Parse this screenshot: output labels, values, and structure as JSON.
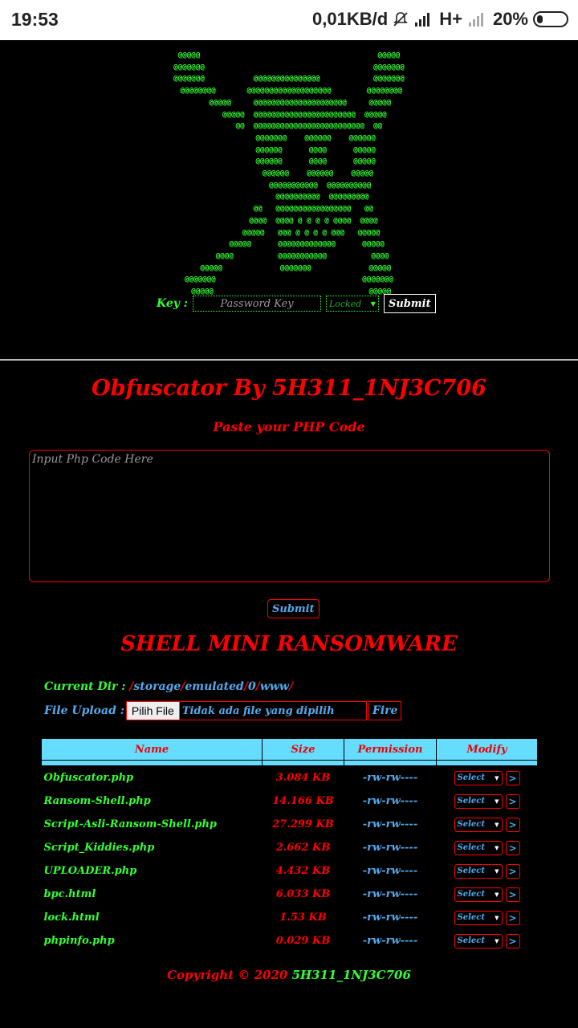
{
  "status": {
    "time": "19:53",
    "speed": "0,01KB/d",
    "network": "H+",
    "battery": "20%"
  },
  "skull_art": "@@@@@                                        @@@@@\n@@@@@@@                                      @@@@@@@\n@@@@@@@           @@@@@@@@@@@@@@@            @@@@@@@\n @@@@@@@@       @@@@@@@@@@@@@@@@@@@        @@@@@@@@\n     @@@@@     @@@@@@@@@@@@@@@@@@@@@     @@@@@\n       @@@@@  @@@@@@@@@@@@@@@@@@@@@@@  @@@@@\n         @@  @@@@@@@@@@@@@@@@@@@@@@@@@  @@\n            @@@@@@@    @@@@@@    @@@@@@\n            @@@@@@      @@@@      @@@@@\n            @@@@@@      @@@@      @@@@@\n             @@@@@@    @@@@@@    @@@@@\n              @@@@@@@@@@@  @@@@@@@@@@\n               @@@@@@@@@@  @@@@@@@@@\n           @@   @@@@@@@@@@@@@@@@@   @@\n           @@@@  @@@@ @ @ @ @ @@@@  @@@@\n          @@@@@   @@@ @ @ @ @ @@@   @@@@@\n        @@@@@      @@@@@@@@@@@@@      @@@@@\n      @@@@          @@@@@@@@@@@          @@@@\n   @@@@@             @@@@@@@             @@@@@\n@@@@@@@                                 @@@@@@@\n @@@@@                                   @@@@@",
  "login": {
    "key_label": "Key :",
    "password_placeholder": "Password Key",
    "locked_option": "Locked",
    "submit_label": "Submit"
  },
  "obfuscator": {
    "title": "Obfuscator By 5H311_1NJ3C706",
    "subtitle": "Paste your PHP Code",
    "placeholder": "Input Php Code Here",
    "submit_label": "Submit"
  },
  "shell": {
    "title": "SHELL MINI RANSOMWARE",
    "current_dir_label": "Current Dir :",
    "path_parts": [
      "storage",
      "emulated",
      "0",
      "www"
    ],
    "upload_label": "File Upload :",
    "choose_file_label": "Pilih File",
    "no_file_text": "Tidak ada file yang dipilih",
    "fire_label": "Fire",
    "columns": [
      "Name",
      "Size",
      "Permission",
      "Modify"
    ],
    "files": [
      {
        "name": "Obfuscator.php",
        "size": "3.084 KB",
        "perm": "-rw-rw----"
      },
      {
        "name": "Ransom-Shell.php",
        "size": "14.166 KB",
        "perm": "-rw-rw----"
      },
      {
        "name": "Script-Asli-Ransom-Shell.php",
        "size": "27.299 KB",
        "perm": "-rw-rw----"
      },
      {
        "name": "Script_Kiddies.php",
        "size": "2.662 KB",
        "perm": "-rw-rw----"
      },
      {
        "name": "UPLOADER.php",
        "size": "4.432 KB",
        "perm": "-rw-rw----"
      },
      {
        "name": "bpc.html",
        "size": "6.033 KB",
        "perm": "-rw-rw----"
      },
      {
        "name": "lock.html",
        "size": "1.53 KB",
        "perm": "-rw-rw----"
      },
      {
        "name": "phpinfo.php",
        "size": "0.029 KB",
        "perm": "-rw-rw----"
      }
    ],
    "select_label": "Select",
    "go_label": ">"
  },
  "footer": {
    "copyright": "Copyright © 2020",
    "author": "5H311_1NJ3C706"
  }
}
